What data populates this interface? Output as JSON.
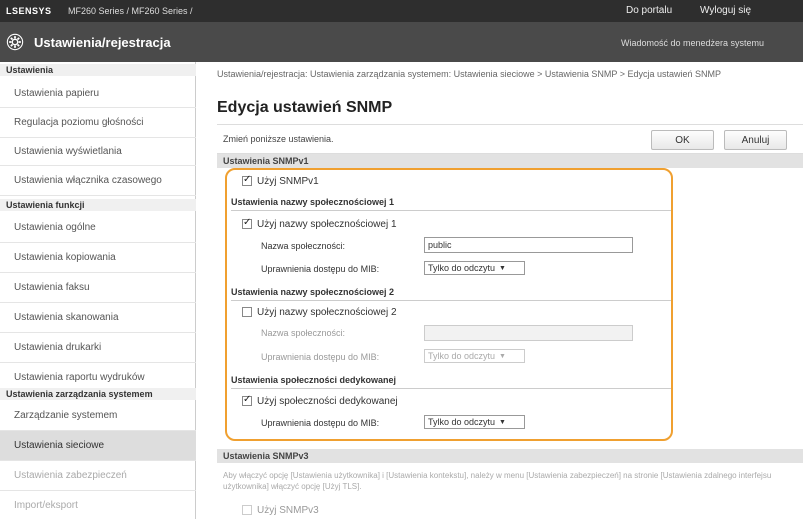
{
  "topbar": {
    "brand": "LSENSYS",
    "model": "MF260 Series / MF260 Series /",
    "portal_link": "Do portalu",
    "logout_link": "Wyloguj się"
  },
  "header": {
    "title": "Ustawienia/rejestracja",
    "message_link": "Wiadomość do menedżera systemu"
  },
  "sidebar": {
    "section1": "Ustawienia",
    "items1": [
      "Ustawienia papieru",
      "Regulacja poziomu głośności",
      "Ustawienia wyświetlania",
      "Ustawienia włącznika czasowego"
    ],
    "section2": "Ustawienia funkcji",
    "items2": [
      "Ustawienia ogólne",
      "Ustawienia kopiowania",
      "Ustawienia faksu",
      "Ustawienia skanowania",
      "Ustawienia drukarki",
      "Ustawienia raportu wydruków"
    ],
    "section3": "Ustawienia zarządzania systemem",
    "items3": [
      "Zarządzanie systemem",
      "Ustawienia sieciowe",
      "Ustawienia zabezpieczeń",
      "Import/eksport"
    ]
  },
  "main": {
    "breadcrumb": "Ustawienia/rejestracja: Ustawienia zarządzania systemem: Ustawienia sieciowe > Ustawienia SNMP > Edycja ustawień SNMP",
    "title": "Edycja ustawień SNMP",
    "instruction": "Zmień poniższe ustawienia.",
    "ok": "OK",
    "cancel": "Anuluj"
  },
  "snmpv1": {
    "header": "Ustawienia SNMPv1",
    "use_label": "Użyj SNMPv1",
    "community1": {
      "heading": "Ustawienia nazwy społecznościowej 1",
      "use_label": "Użyj nazwy społecznościowej 1",
      "name_label": "Nazwa społeczności:",
      "name_value": "public",
      "access_label": "Uprawnienia dostępu do MIB:",
      "access_value": "Tylko do odczytu"
    },
    "community2": {
      "heading": "Ustawienia nazwy społecznościowej 2",
      "use_label": "Użyj nazwy społecznościowej 2",
      "name_label": "Nazwa społeczności:",
      "name_value": "",
      "access_label": "Uprawnienia dostępu do MIB:",
      "access_value": "Tylko do odczytu"
    },
    "dedicated": {
      "heading": "Ustawienia społeczności dedykowanej",
      "use_label": "Użyj społeczności dedykowanej",
      "access_label": "Uprawnienia dostępu do MIB:",
      "access_value": "Tylko do odczytu"
    }
  },
  "snmpv3": {
    "header": "Ustawienia SNMPv3",
    "note": "Aby włączyć opcję [Ustawienia użytkownika] i [Ustawienia kontekstu], należy w menu [Ustawienia zabezpieczeń] na stronie [Ustawienia zdalnego interfejsu użytkownika] włączyć opcję [Użyj TLS].",
    "use_label": "Użyj SNMPv3"
  },
  "colors": {
    "highlight": "#f0a030",
    "header_bg": "#4a4a4a",
    "topbar_bg": "#2e2e2e"
  }
}
